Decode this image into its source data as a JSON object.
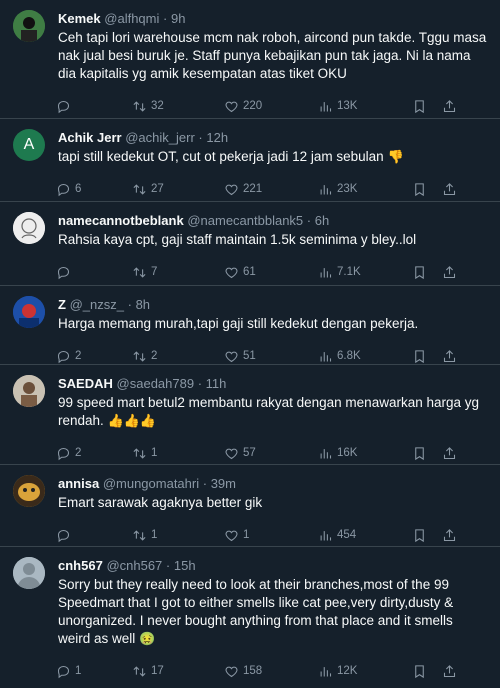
{
  "tweets": [
    {
      "name": "Kemek",
      "handle": "@alfhqmi",
      "time": "9h",
      "text": "Ceh tapi lori warehouse mcm nak roboh, aircond pun takde. Tggu masa nak jual besi buruk je. Staff punya kebajikan pun tak jaga. Ni la nama dia kapitalis yg amik kesempatan atas tiket OKU",
      "emoji": "",
      "replies": "",
      "retweets": "32",
      "likes": "220",
      "views": "13K",
      "avatar_color": "#2f6e3a",
      "avatar_letter": ""
    },
    {
      "name": "Achik Jerr",
      "handle": "@achik_jerr",
      "time": "12h",
      "text": "tapi still kedekut OT, cut ot pekerja jadi 12 jam sebulan",
      "emoji": "👎",
      "replies": "6",
      "retweets": "27",
      "likes": "221",
      "views": "23K",
      "avatar_color": "#1e7a4f",
      "avatar_letter": "A"
    },
    {
      "name": "namecannotbeblank",
      "handle": "@namecantbblank5",
      "time": "6h",
      "text": "Rahsia kaya cpt, gaji staff maintain 1.5k seminima y bley..lol",
      "emoji": "",
      "replies": "",
      "retweets": "7",
      "likes": "61",
      "views": "7.1K",
      "avatar_color": "#e8e8e8",
      "avatar_letter": ""
    },
    {
      "name": "Z",
      "handle": "@_nzsz_",
      "time": "8h",
      "text": "Harga memang murah,tapi gaji still kedekut dengan pekerja.",
      "emoji": "",
      "replies": "2",
      "retweets": "2",
      "likes": "51",
      "views": "6.8K",
      "avatar_color": "#1d4fa8",
      "avatar_letter": ""
    },
    {
      "name": "SAEDAH",
      "handle": "@saedah789",
      "time": "11h",
      "text": "99 speed mart betul2 membantu rakyat dengan menawarkan harga yg rendah.",
      "emoji": "👍👍👍",
      "replies": "2",
      "retweets": "1",
      "likes": "57",
      "views": "16K",
      "avatar_color": "#b9b2a6",
      "avatar_letter": ""
    },
    {
      "name": "annisa",
      "handle": "@mungomatahri",
      "time": "39m",
      "text": "Emart sarawak agaknya better gik",
      "emoji": "",
      "replies": "",
      "retweets": "1",
      "likes": "1",
      "views": "454",
      "avatar_color": "#d6a23a",
      "avatar_letter": ""
    },
    {
      "name": "cnh567",
      "handle": "@cnh567",
      "time": "15h",
      "text": "Sorry but they really need to look at their branches,most of the 99 Speedmart that I got to either smells like cat pee,very dirty,dusty & unorganized. I never bought anything from that place and it smells weird as well",
      "emoji": "🤢",
      "replies": "1",
      "retweets": "17",
      "likes": "158",
      "views": "12K",
      "avatar_color": "#aab8c2",
      "avatar_letter": ""
    }
  ]
}
